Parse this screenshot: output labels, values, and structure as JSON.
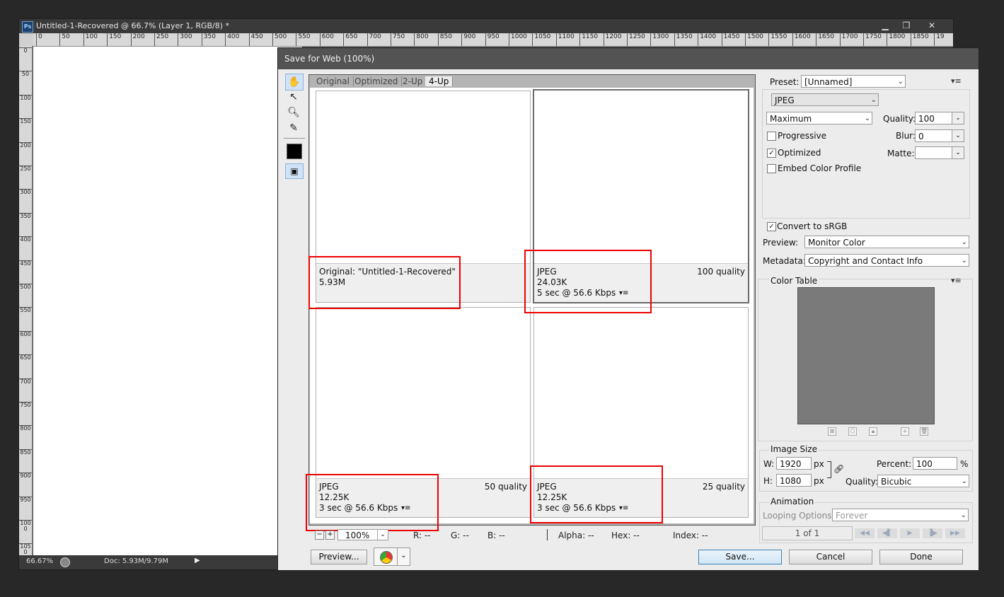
{
  "ps": {
    "logo": "Ps",
    "document_title": "Untitled-1-Recovered @ 66.7% (Layer 1, RGB/8) *",
    "window_buttons": {
      "minimize": "▁",
      "restore": "❐",
      "close": "✕"
    },
    "ruler_h": [
      "0",
      "50",
      "100",
      "150",
      "200",
      "250",
      "300",
      "350",
      "400",
      "450",
      "500",
      "550",
      "600",
      "650",
      "700",
      "750",
      "800",
      "850",
      "900",
      "950",
      "1000",
      "1050",
      "1100",
      "1150",
      "1200",
      "1250",
      "1300",
      "1350",
      "1400",
      "1450",
      "1500",
      "1550",
      "1600",
      "1650",
      "1700",
      "1750",
      "1800",
      "1850",
      "19"
    ],
    "ruler_v": [
      "0",
      "50",
      "100",
      "150",
      "200",
      "250",
      "300",
      "350",
      "400",
      "450",
      "500",
      "550",
      "600",
      "650",
      "700",
      "750",
      "800",
      "850",
      "900",
      "950",
      "1000",
      "1050"
    ],
    "status": {
      "zoom": "66.67%",
      "doc": "Doc: 5.93M/9.79M",
      "arrow": "▶"
    }
  },
  "dialog": {
    "title": "Save for Web (100%)",
    "tabs": [
      "Original",
      "Optimized",
      "2-Up",
      "4-Up"
    ],
    "active_tab": "4-Up",
    "panes": [
      {
        "line1": "Original: \"Untitled-1-Recovered\"",
        "line2": "5.93M",
        "line3": "",
        "quality": ""
      },
      {
        "line1": "JPEG",
        "line2": "24.03K",
        "line3": "5 sec @ 56.6 Kbps",
        "quality": "100 quality"
      },
      {
        "line1": "JPEG",
        "line2": "12.25K",
        "line3": "3 sec @ 56.6 Kbps",
        "quality": "50 quality"
      },
      {
        "line1": "JPEG",
        "line2": "12.25K",
        "line3": "3 sec @ 56.6 Kbps",
        "quality": "25 quality"
      }
    ],
    "pane_menu_glyph": "▾≡",
    "zoom": {
      "minus": "−",
      "plus": "+",
      "value": "100%",
      "dd": "⌄"
    },
    "pixel_info": {
      "r": "R: --",
      "g": "G: --",
      "b": "B: --",
      "alpha": "Alpha: --",
      "hex": "Hex: --",
      "index": "Index: --"
    },
    "buttons": {
      "preview": "Preview...",
      "save": "Save...",
      "cancel": "Cancel",
      "done": "Done"
    },
    "settings": {
      "preset_label": "Preset:",
      "preset_value": "[Unnamed]",
      "panel_menu": "▾≡",
      "format": "JPEG",
      "compression": "Maximum",
      "quality_label": "Quality:",
      "quality_value": "100",
      "blur_label": "Blur:",
      "blur_value": "0",
      "matte_label": "Matte:",
      "matte_value": "",
      "progressive_label": "Progressive",
      "progressive_checked": false,
      "optimized_label": "Optimized",
      "optimized_checked": true,
      "embed_profile_label": "Embed Color Profile",
      "embed_profile_checked": false,
      "convert_srgb_label": "Convert to sRGB",
      "convert_srgb_checked": true,
      "preview_label": "Preview:",
      "preview_value": "Monitor Color",
      "metadata_label": "Metadata:",
      "metadata_value": "Copyright and Contact Info"
    },
    "color_table": {
      "title": "Color Table",
      "menu": "▾≡"
    },
    "image_size": {
      "title": "Image Size",
      "w_label": "W:",
      "w_value": "1920",
      "h_label": "H:",
      "h_value": "1080",
      "px": "px",
      "percent_label": "Percent:",
      "percent_value": "100",
      "percent_unit": "%",
      "quality_label": "Quality:",
      "quality_value": "Bicubic"
    },
    "animation": {
      "title": "Animation",
      "looping_label": "Looping Options:",
      "looping_value": "Forever",
      "frame_counter": "1 of 1",
      "controls": [
        "◀◀",
        "◀▌",
        "▶",
        "▐▶",
        "▶▶"
      ]
    },
    "highlight_color": "#ee0000"
  }
}
